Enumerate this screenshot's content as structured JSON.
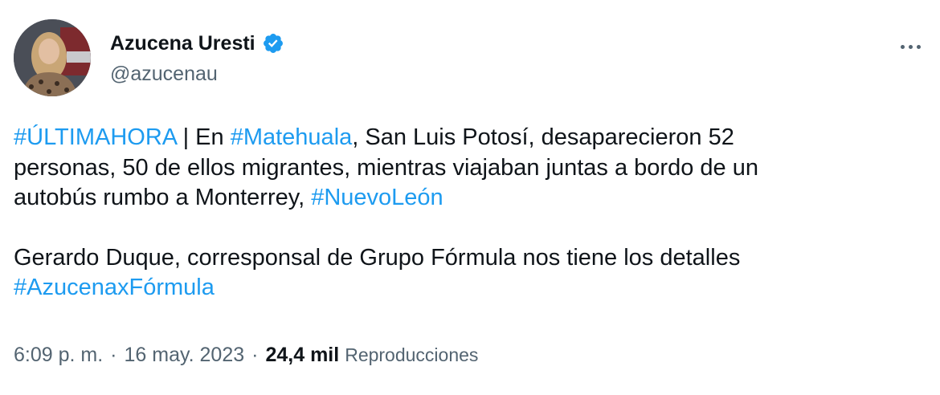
{
  "author": {
    "display_name": "Azucena Uresti",
    "handle": "@azucenau",
    "verified": true,
    "verified_icon": "verified-badge-icon",
    "verified_color": "#1d9bf0"
  },
  "menu": {
    "icon": "more-options-icon"
  },
  "tweet": {
    "para1": {
      "tag1": "#ÚLTIMAHORA",
      "t1": " | En ",
      "tag2": "#Matehuala",
      "t2": ", San Luis Potosí, desaparecieron 52",
      "line2": "personas, 50 de ellos migrantes, mientras viajaban juntas a bordo de un",
      "t3": "autobús rumbo a Monterrey, ",
      "tag3": "#NuevoLeón"
    },
    "para2": {
      "text": "Gerardo Duque, corresponsal de Grupo Fórmula nos tiene los detalles",
      "tag": "#AzucenaxFórmula"
    }
  },
  "meta": {
    "time": "6:09 p. m.",
    "separator": "·",
    "date": "16 may. 2023",
    "views_count": "24,4 mil",
    "views_label": "Reproducciones"
  },
  "colors": {
    "link": "#1d9bf0",
    "text": "#0f1419",
    "secondary": "#536471",
    "background": "#ffffff"
  }
}
